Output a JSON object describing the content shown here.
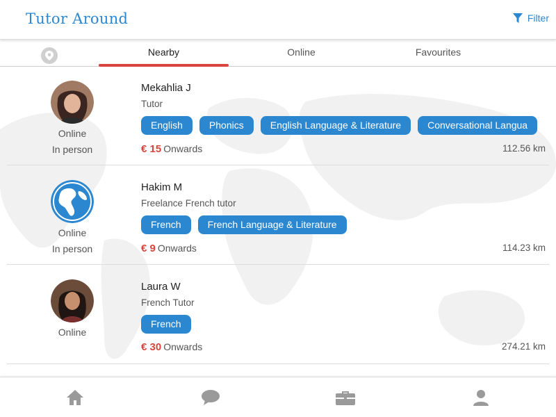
{
  "header": {
    "title": "Tutor Around",
    "filter_label": "Filter"
  },
  "tabs": [
    {
      "label": "Nearby",
      "active": true
    },
    {
      "label": "Online",
      "active": false
    },
    {
      "label": "Favourites",
      "active": false
    }
  ],
  "tutors": [
    {
      "name": "Mekahlia J",
      "role": "Tutor",
      "modes": [
        "Online",
        "In person"
      ],
      "tags": [
        "English",
        "Phonics",
        "English Language & Literature",
        "Conversational Langua"
      ],
      "price": "€ 15",
      "price_suffix": "Onwards",
      "distance": "112.56 km"
    },
    {
      "name": "Hakim M",
      "role": "Freelance French tutor",
      "modes": [
        "Online",
        "In person"
      ],
      "tags": [
        "French",
        "French Language & Literature"
      ],
      "price": "€ 9",
      "price_suffix": "Onwards",
      "distance": "114.23 km"
    },
    {
      "name": "Laura W",
      "role": "French Tutor",
      "modes": [
        "Online"
      ],
      "tags": [
        "French"
      ],
      "price": "€ 30",
      "price_suffix": "Onwards",
      "distance": "274.21 km"
    }
  ],
  "bottom_nav": [
    {
      "icon": "home-icon"
    },
    {
      "icon": "chat-icon"
    },
    {
      "icon": "briefcase-icon"
    },
    {
      "icon": "profile-icon"
    }
  ],
  "colors": {
    "accent": "#2a87d0",
    "price": "#d9453e",
    "tab_underline": "#d9453e"
  }
}
